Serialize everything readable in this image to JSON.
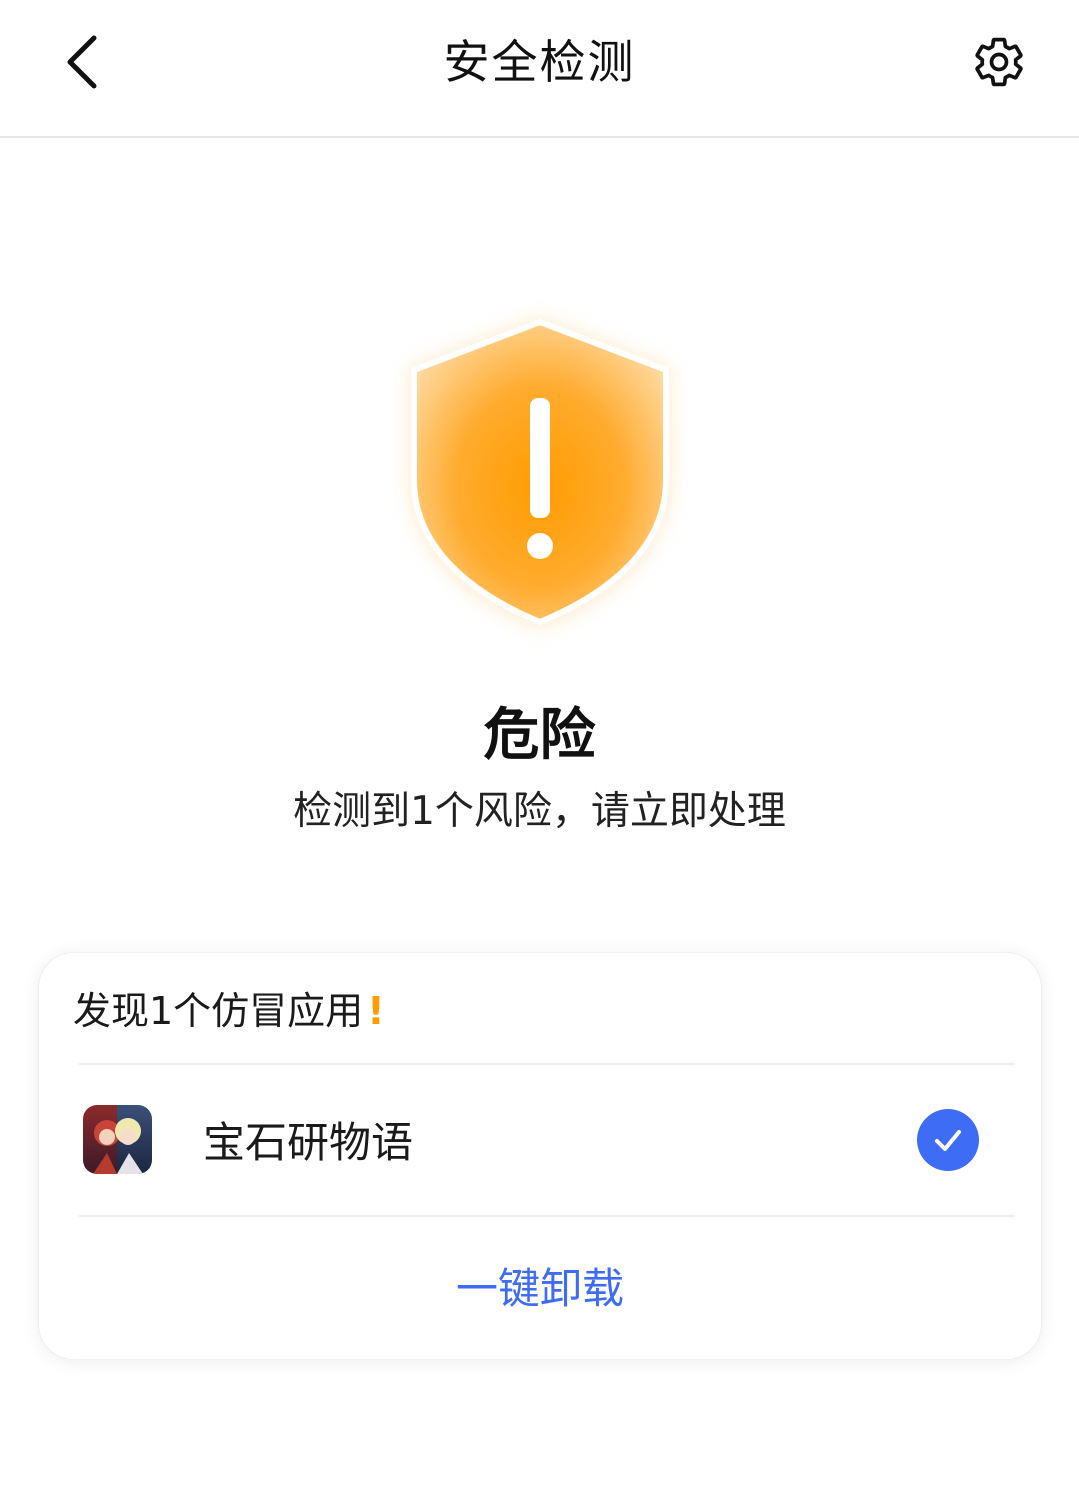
{
  "header": {
    "title": "安全检测",
    "back_icon": "chevron-left-icon",
    "settings_icon": "gear-icon"
  },
  "status": {
    "level": "危险",
    "message": "检测到1个风险，请立即处理",
    "shield_icon": "warning-shield-icon",
    "color": "#ff9c00"
  },
  "risk_card": {
    "header_text": "发现1个仿冒应用",
    "header_mark": "!",
    "apps": [
      {
        "name": "宝石研物语",
        "selected": true
      }
    ],
    "action_label": "一键卸载",
    "accent_color": "#3f6cf4"
  }
}
